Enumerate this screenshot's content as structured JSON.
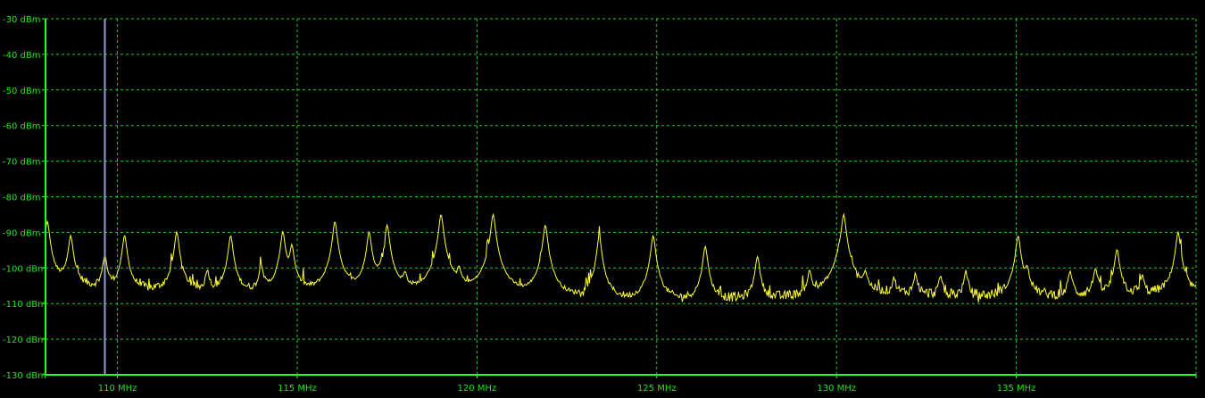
{
  "chart_data": {
    "type": "line",
    "title": "",
    "xlabel": "",
    "ylabel": "",
    "xlim": [
      108.0,
      140.0
    ],
    "ylim": [
      -130,
      -30
    ],
    "grid": true,
    "colors": {
      "background": "#000000",
      "grid": "#1fcf1f",
      "axis": "#22ff22",
      "text": "#21e321",
      "trace": "#ffff33",
      "marker": "#9a9ad8"
    },
    "x_ticks": [
      {
        "value": 110,
        "label": "110 MHz"
      },
      {
        "value": 115,
        "label": "115 MHz"
      },
      {
        "value": 120,
        "label": "120 MHz"
      },
      {
        "value": 125,
        "label": "125 MHz"
      },
      {
        "value": 130,
        "label": "130 MHz"
      },
      {
        "value": 135,
        "label": "135 MHz"
      },
      {
        "value": 140,
        "label": ""
      }
    ],
    "y_ticks": [
      {
        "value": -30,
        "label": "-30 dBm"
      },
      {
        "value": -40,
        "label": "-40 dBm"
      },
      {
        "value": -50,
        "label": "-50 dBm"
      },
      {
        "value": -60,
        "label": "-60 dBm"
      },
      {
        "value": -70,
        "label": "-70 dBm"
      },
      {
        "value": -80,
        "label": "-80 dBm"
      },
      {
        "value": -90,
        "label": "-90 dBm"
      },
      {
        "value": -100,
        "label": "-100 dBm"
      },
      {
        "value": -110,
        "label": "-110 dBm"
      },
      {
        "value": -120,
        "label": "-120 dBm"
      },
      {
        "value": -130,
        "label": "-130 dBm"
      }
    ],
    "marker_x": 109.65,
    "noise_floor": [
      [
        108.0,
        -106
      ],
      [
        109.7,
        -107
      ],
      [
        112.0,
        -108
      ],
      [
        115.0,
        -109
      ],
      [
        118.0,
        -110
      ],
      [
        120.0,
        -111
      ],
      [
        122.0,
        -111
      ],
      [
        125.0,
        -111
      ],
      [
        127.0,
        -110
      ],
      [
        130.0,
        -109
      ],
      [
        132.0,
        -108
      ],
      [
        135.0,
        -109
      ],
      [
        137.0,
        -108
      ],
      [
        140.0,
        -108
      ]
    ],
    "peaks": [
      {
        "x": 108.05,
        "y": -87
      },
      {
        "x": 108.7,
        "y": -91
      },
      {
        "x": 109.65,
        "y": -97
      },
      {
        "x": 110.2,
        "y": -91
      },
      {
        "x": 111.65,
        "y": -90
      },
      {
        "x": 112.5,
        "y": -102
      },
      {
        "x": 113.15,
        "y": -91
      },
      {
        "x": 114.0,
        "y": -100
      },
      {
        "x": 114.6,
        "y": -90
      },
      {
        "x": 114.85,
        "y": -94
      },
      {
        "x": 116.05,
        "y": -87
      },
      {
        "x": 117.0,
        "y": -90
      },
      {
        "x": 117.5,
        "y": -88
      },
      {
        "x": 118.0,
        "y": -104
      },
      {
        "x": 119.0,
        "y": -85
      },
      {
        "x": 119.5,
        "y": -102
      },
      {
        "x": 120.45,
        "y": -85
      },
      {
        "x": 121.9,
        "y": -88
      },
      {
        "x": 123.4,
        "y": -91
      },
      {
        "x": 124.9,
        "y": -91
      },
      {
        "x": 126.35,
        "y": -94
      },
      {
        "x": 127.8,
        "y": -97
      },
      {
        "x": 129.25,
        "y": -102
      },
      {
        "x": 130.05,
        "y": -100
      },
      {
        "x": 130.2,
        "y": -85
      },
      {
        "x": 130.8,
        "y": -103
      },
      {
        "x": 131.6,
        "y": -105
      },
      {
        "x": 132.2,
        "y": -103
      },
      {
        "x": 132.9,
        "y": -104
      },
      {
        "x": 133.6,
        "y": -102
      },
      {
        "x": 135.05,
        "y": -91
      },
      {
        "x": 135.3,
        "y": -101
      },
      {
        "x": 136.5,
        "y": -102
      },
      {
        "x": 137.2,
        "y": -101
      },
      {
        "x": 137.8,
        "y": -95
      },
      {
        "x": 138.5,
        "y": -104
      },
      {
        "x": 139.5,
        "y": -90
      }
    ]
  }
}
